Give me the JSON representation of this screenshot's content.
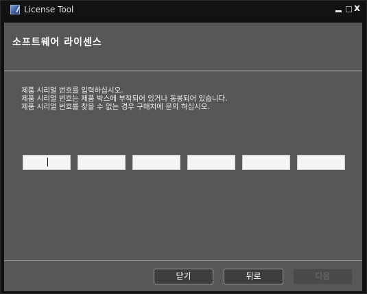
{
  "window": {
    "title": "License Tool",
    "icon": "license-app-icon",
    "controls": {
      "minimize_icon": "minimize-icon",
      "maximize_icon": "maximize-icon",
      "close_glyph": "x"
    }
  },
  "header": {
    "title": "소프트웨어 라이센스"
  },
  "instructions": [
    "제품 시리얼 번호를 입력하십시오.",
    "제품 시리얼 번호는 제품 박스에 부착되어 있거나 동봉되어 있습니다.",
    "제품 시리얼 번호를 찾을 수 없는 경우 구매처에 문의 하십시오."
  ],
  "serial_fields": [
    {
      "value": ""
    },
    {
      "value": ""
    },
    {
      "value": ""
    },
    {
      "value": ""
    },
    {
      "value": ""
    },
    {
      "value": ""
    }
  ],
  "buttons": {
    "close_label": "닫기",
    "back_label": "뒤로",
    "next_label": "다음"
  },
  "colors": {
    "titlebar_bg": "#121212",
    "panel_bg": "#575757",
    "button_bg": "#3d3d3d",
    "disabled_text": "#6e6e6e"
  }
}
